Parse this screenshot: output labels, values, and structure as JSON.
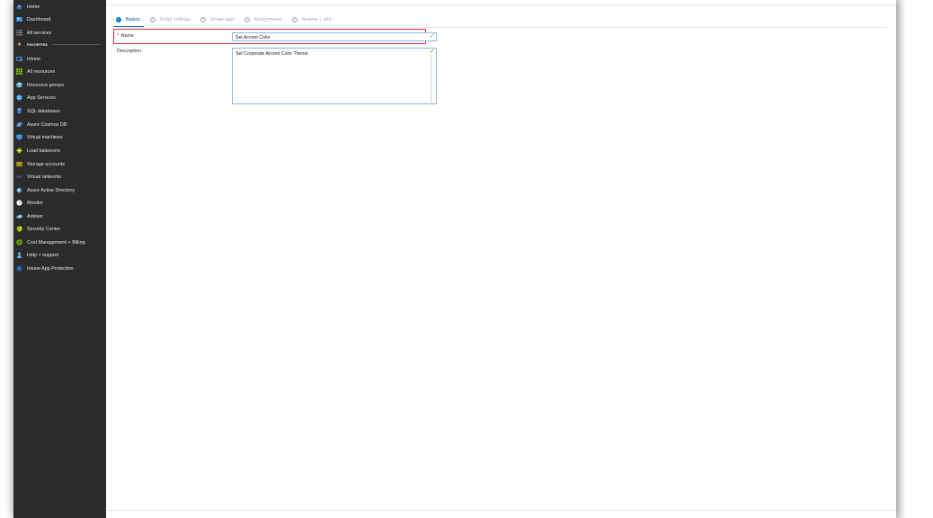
{
  "sidebar": {
    "items": [
      {
        "label": "Home",
        "icon": "home-icon",
        "color": "#3b9ef5"
      },
      {
        "label": "Dashboard",
        "icon": "dashboard-icon",
        "color": "#3b9ef5"
      },
      {
        "label": "All services",
        "icon": "list-icon",
        "color": "#b5b5b5"
      }
    ],
    "favorites_header": "FAVORITES",
    "favorites": [
      {
        "label": "Intune",
        "icon": "intune-icon",
        "color": "#4a90d9"
      },
      {
        "label": "All resources",
        "icon": "grid-icon",
        "color": "#7fba00"
      },
      {
        "label": "Resource groups",
        "icon": "cube-icon",
        "color": "#59b4d9"
      },
      {
        "label": "App Services",
        "icon": "globe-icon",
        "color": "#3aa0f3"
      },
      {
        "label": "SQL databases",
        "icon": "database-icon",
        "color": "#3b78d8"
      },
      {
        "label": "Azure Cosmos DB",
        "icon": "planet-icon",
        "color": "#3b9ef5"
      },
      {
        "label": "Virtual machines",
        "icon": "monitor-icon",
        "color": "#3b9ef5"
      },
      {
        "label": "Load balancers",
        "icon": "diamond-icon",
        "color": "#7fba00"
      },
      {
        "label": "Storage accounts",
        "icon": "storage-icon",
        "color": "#c8a900"
      },
      {
        "label": "Virtual networks",
        "icon": "network-icon",
        "color": "#4f6bed"
      },
      {
        "label": "Azure Active Directory",
        "icon": "pyramid-icon",
        "color": "#59b4d9"
      },
      {
        "label": "Monitor",
        "icon": "gauge-icon",
        "color": "#ffffff"
      },
      {
        "label": "Advisor",
        "icon": "cloud-icon",
        "color": "#59b4d9"
      },
      {
        "label": "Security Center",
        "icon": "shield-icon",
        "color": "#7fba00"
      },
      {
        "label": "Cost Management + Billing",
        "icon": "coin-icon",
        "color": "#7fba00"
      },
      {
        "label": "Help + support",
        "icon": "person-icon",
        "color": "#59b4d9"
      },
      {
        "label": "Intune App Protection",
        "icon": "app-protection-icon",
        "color": "#2b5797"
      }
    ]
  },
  "wizard": {
    "tabs": [
      {
        "num": "1",
        "label": "Basics",
        "active": true
      },
      {
        "num": "2",
        "label": "Script settings",
        "active": false
      },
      {
        "num": "3",
        "label": "Scope tags",
        "active": false
      },
      {
        "num": "4",
        "label": "Assignments",
        "active": false
      },
      {
        "num": "5",
        "label": "Review + add",
        "active": false
      }
    ]
  },
  "form": {
    "name_required_mark": "*",
    "name_label": "Name",
    "name_value": "Set Accent Color",
    "description_label": "Description",
    "description_value": "Set Corporate Accent Color Theme"
  },
  "colors": {
    "sidebar_bg": "#2b2b2b",
    "accent": "#0078d4",
    "highlight": "#d22c43",
    "valid": "#57a300"
  }
}
